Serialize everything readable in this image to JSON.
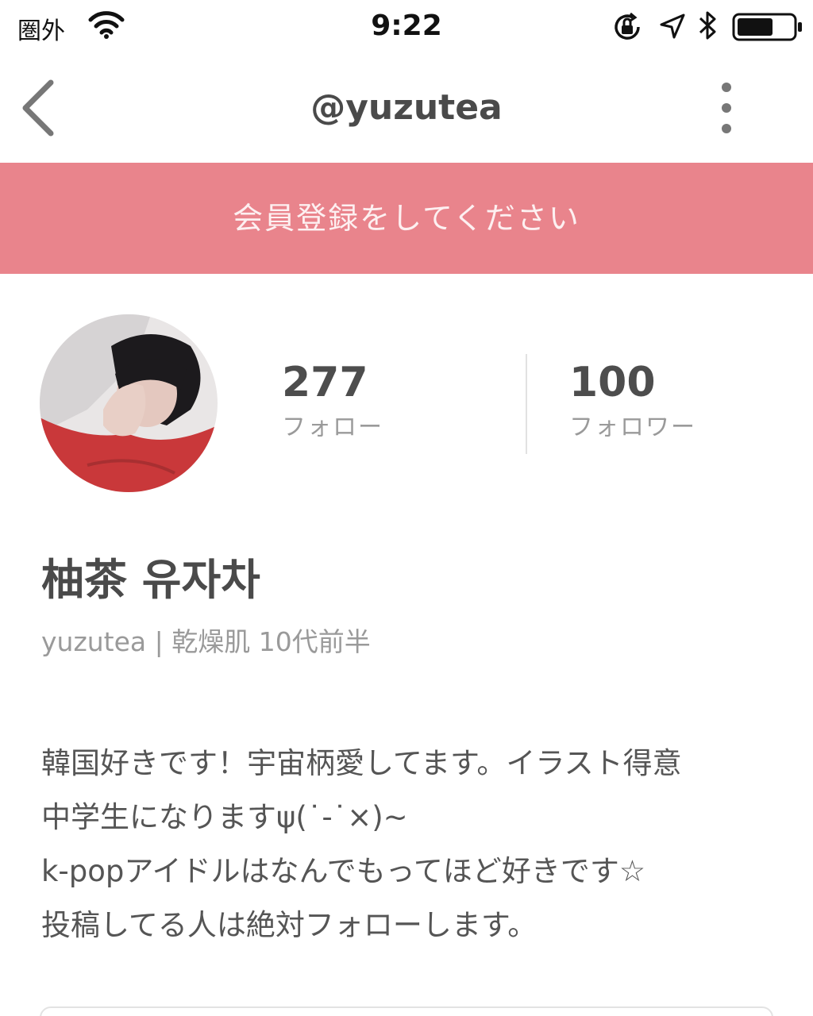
{
  "status_bar": {
    "carrier": "圏外",
    "time": "9:22",
    "icons": [
      "wifi-icon",
      "orientation-lock-icon",
      "location-arrow-icon",
      "bluetooth-icon",
      "battery-icon"
    ]
  },
  "nav": {
    "title": "@yuzutea",
    "back_icon": "chevron-left-icon",
    "more_icon": "more-vertical-icon"
  },
  "banner": {
    "text": "会員登録をしてください",
    "color": "#e9848c"
  },
  "profile": {
    "following_count": "277",
    "following_label": "フォロー",
    "followers_count": "100",
    "followers_label": "フォロワー",
    "display_name": "柚茶 유자차",
    "meta": "yuzutea | 乾燥肌  10代前半",
    "bio": [
      "韓国好きです！宇宙柄愛してます。イラスト得意",
      "中学生になりますψ(˙-˙×)~",
      "k-popアイドルはなんでもってほど好きです☆",
      "投稿してる人は絶対フォローします。"
    ]
  }
}
